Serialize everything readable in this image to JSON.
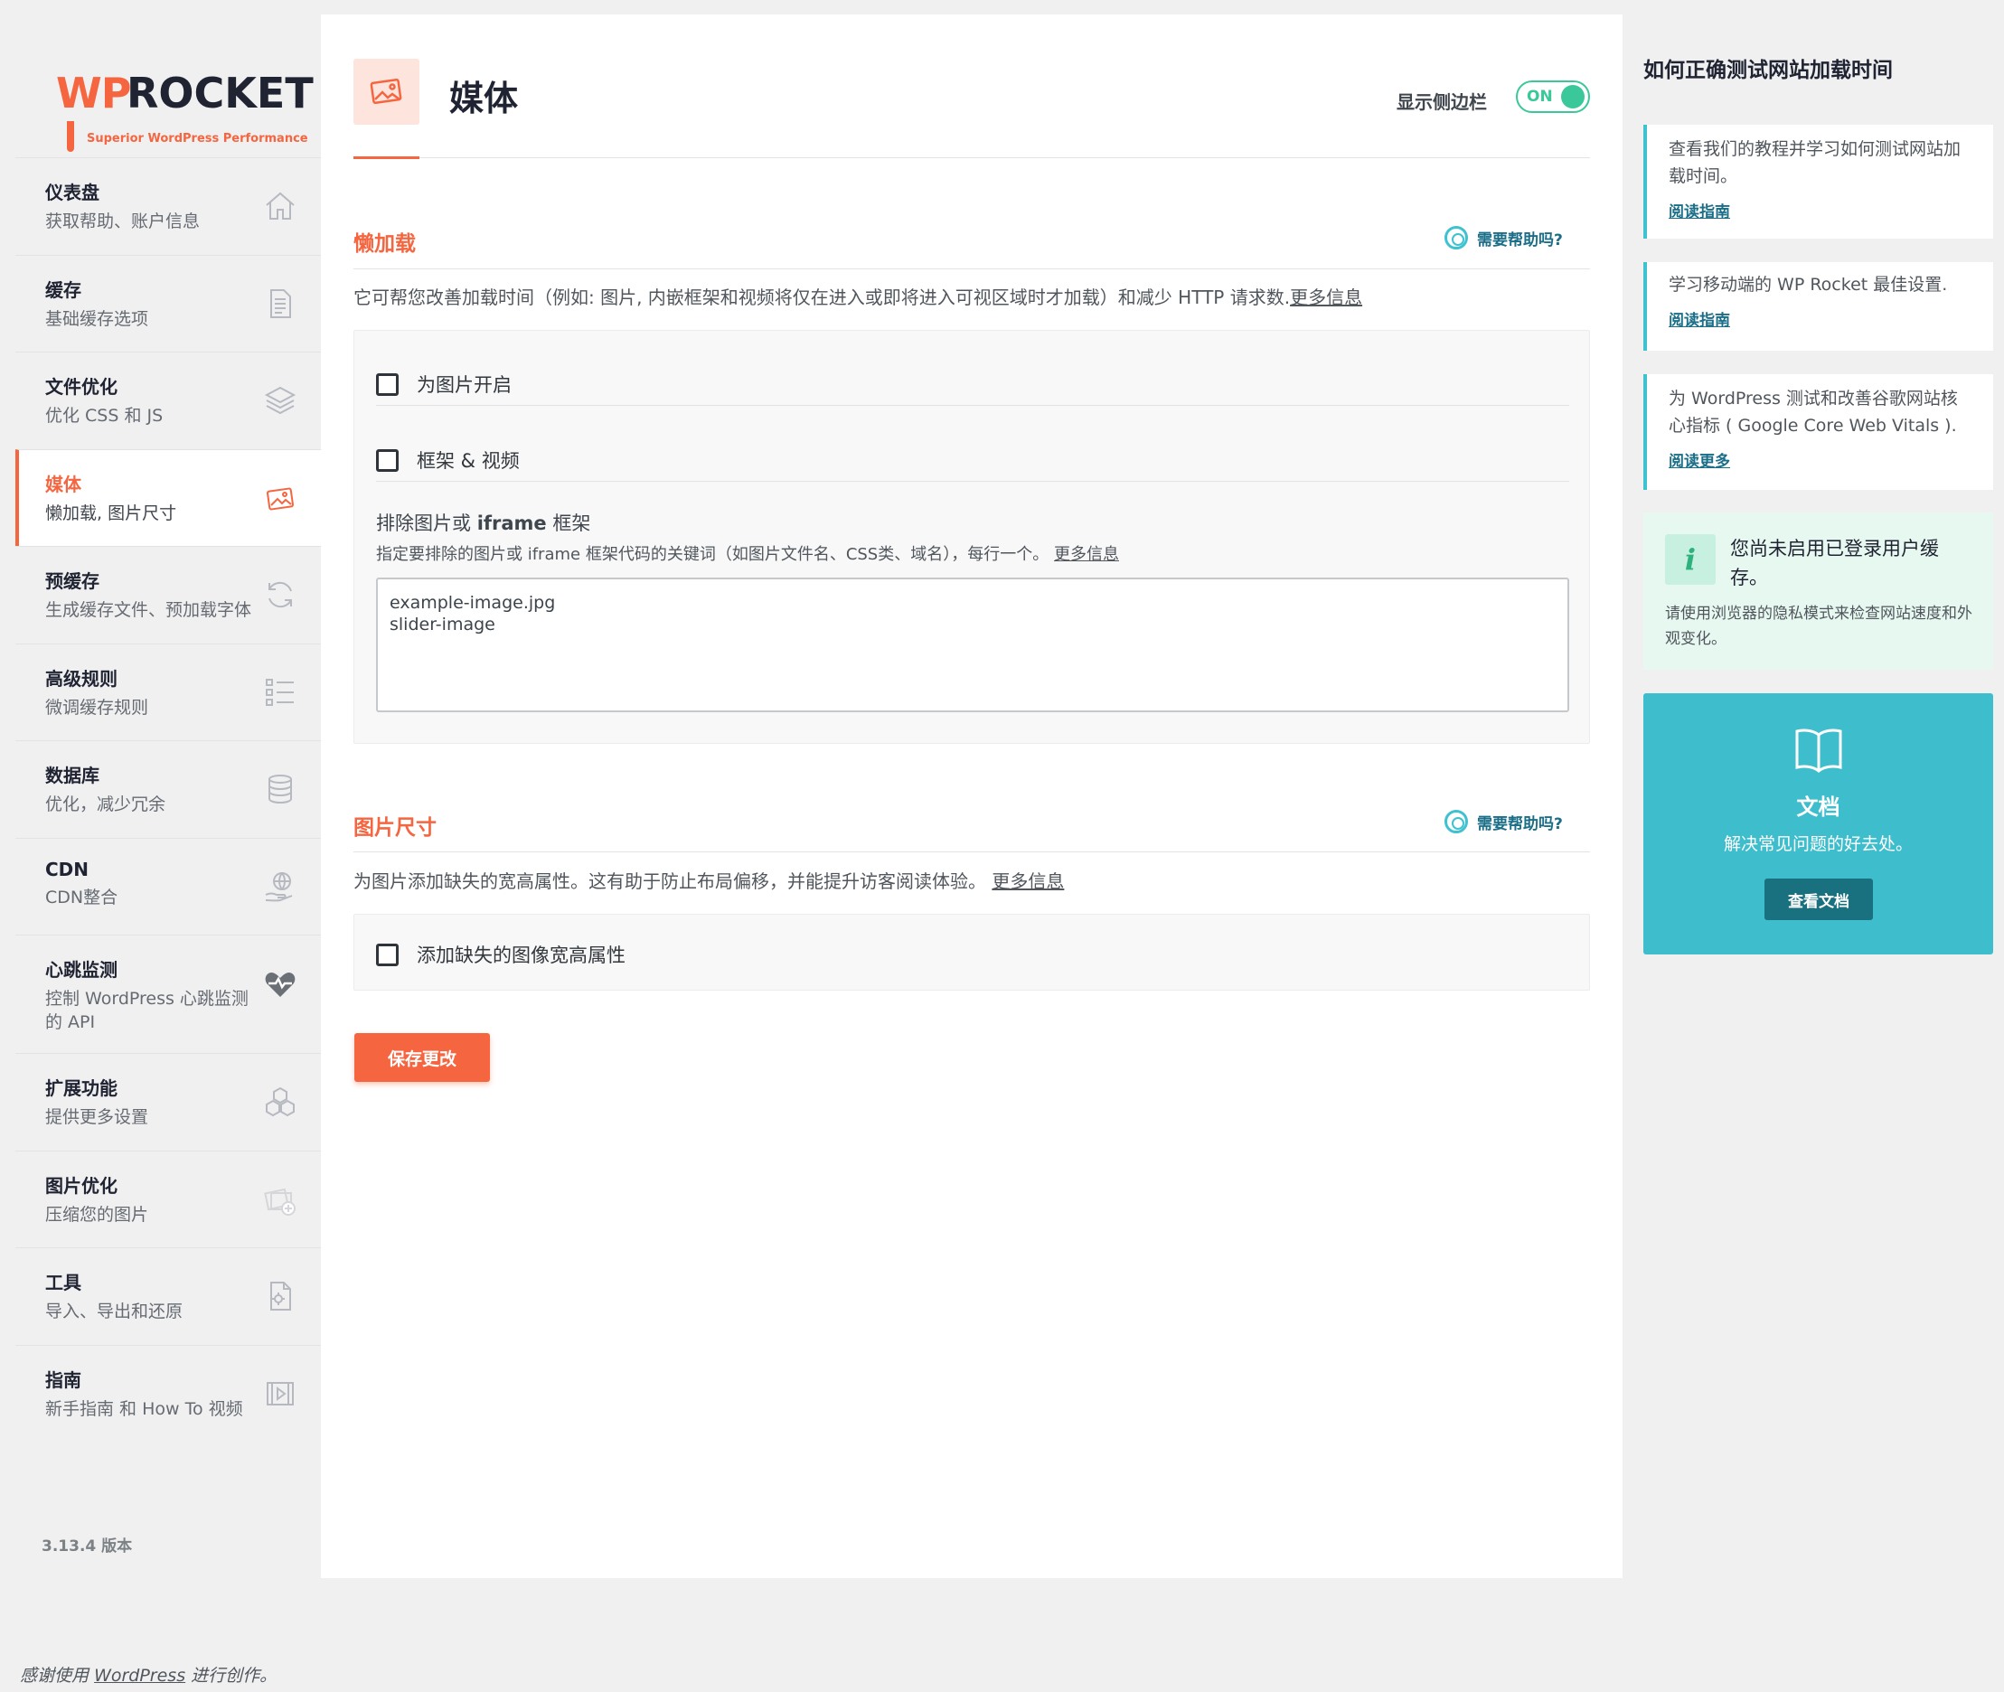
{
  "logo": {
    "wp": "WP",
    "rocket": "ROCKET",
    "tagline": "Superior WordPress Performance"
  },
  "nav": [
    {
      "title": "仪表盘",
      "desc": "获取帮助、账户信息",
      "icon": "home-icon"
    },
    {
      "title": "缓存",
      "desc": "基础缓存选项",
      "icon": "document-icon"
    },
    {
      "title": "文件优化",
      "desc": "优化 CSS 和 JS",
      "icon": "layers-icon"
    },
    {
      "title": "媒体",
      "desc": "懒加载, 图片尺寸",
      "icon": "image-icon",
      "active": true
    },
    {
      "title": "预缓存",
      "desc": "生成缓存文件、预加载字体",
      "icon": "refresh-icon"
    },
    {
      "title": "高级规则",
      "desc": "微调缓存规则",
      "icon": "list-icon"
    },
    {
      "title": "数据库",
      "desc": "优化，减少冗余",
      "icon": "database-icon"
    },
    {
      "title": "CDN",
      "desc": "CDN整合",
      "icon": "globe-hand-icon"
    },
    {
      "title": "心跳监测",
      "desc": "控制 WordPress 心跳监测的 API",
      "icon": "heartbeat-icon"
    },
    {
      "title": "扩展功能",
      "desc": "提供更多设置",
      "icon": "cubes-icon"
    },
    {
      "title": "图片优化",
      "desc": "压缩您的图片",
      "icon": "photos-icon"
    },
    {
      "title": "工具",
      "desc": "导入、导出和还原",
      "icon": "file-gear-icon"
    },
    {
      "title": "指南",
      "desc": "新手指南 和 How To 视频",
      "icon": "video-icon"
    }
  ],
  "version": "3.13.4 版本",
  "header": {
    "title": "媒体",
    "sidebar_toggle_label": "显示侧边栏",
    "toggle_state": "ON"
  },
  "lazyload": {
    "title": "懒加载",
    "help": "需要帮助吗?",
    "desc": "它可帮您改善加载时间（例如: 图片, 内嵌框架和视频将仅在进入或即将进入可视区域时才加载）和减少 HTTP 请求数.",
    "more": "更多信息",
    "opt_images": "为图片开启",
    "opt_iframes": "框架 & 视频",
    "exclude_title_a": "排除图片或",
    "exclude_title_b": "iframe",
    "exclude_title_c": "框架",
    "exclude_desc": "指定要排除的图片或 iframe 框架代码的关键词（如图片文件名、CSS类、域名），每行一个。",
    "exclude_more": "更多信息",
    "exclude_value": "example-image.jpg\nslider-image"
  },
  "dimensions": {
    "title": "图片尺寸",
    "help": "需要帮助吗?",
    "desc": "为图片添加缺失的宽高属性。这有助于防止布局偏移，并能提升访客阅读体验。",
    "more": "更多信息",
    "opt": "添加缺失的图像宽高属性"
  },
  "save_label": "保存更改",
  "right": {
    "title": "如何正确测试网站加载时间",
    "cards": [
      {
        "text": "查看我们的教程并学习如何测试网站加载时间。",
        "link": "阅读指南"
      },
      {
        "text": "学习移动端的 WP Rocket 最佳设置.",
        "link": "阅读指南"
      },
      {
        "text": "为 WordPress 测试和改善谷歌网站核心指标 ( Google Core Web Vitals ).",
        "link": "阅读更多"
      }
    ],
    "info": {
      "badge": "i",
      "title": "您尚未启用已登录用户缓存。",
      "desc": "请使用浏览器的隐私模式来检查网站速度和外观变化。"
    },
    "docs": {
      "title": "文档",
      "desc": "解决常见问题的好去处。",
      "button": "查看文档"
    }
  },
  "footer": {
    "pre": "感谢使用",
    "link": "WordPress",
    "post": "进行创作。"
  },
  "colors": {
    "accent": "#f56640",
    "teal": "#3ebecd",
    "green": "#3ac89a"
  }
}
